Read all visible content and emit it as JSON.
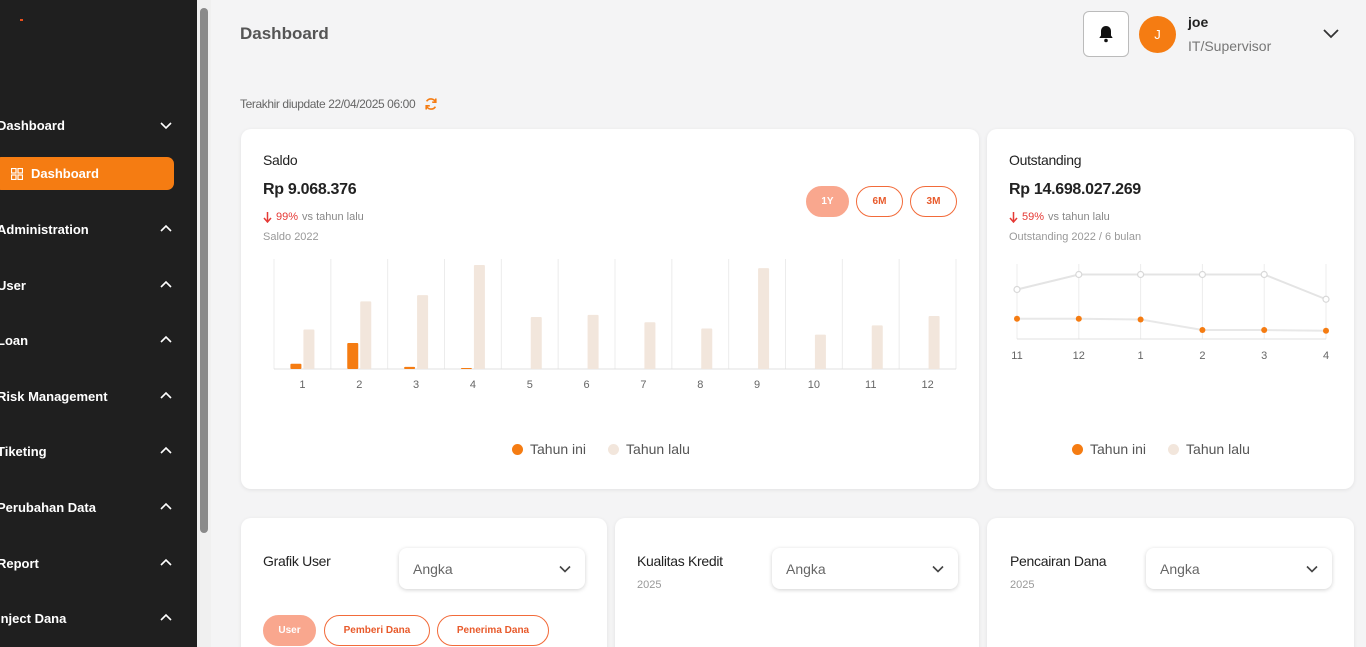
{
  "sidebar": {
    "groups": [
      {
        "label": "Dashboard",
        "expanded": true
      },
      {
        "label": "Administration",
        "expanded": false
      },
      {
        "label": "User",
        "expanded": false
      },
      {
        "label": "Loan",
        "expanded": false
      },
      {
        "label": "Risk Management",
        "expanded": false
      },
      {
        "label": "Tiketing",
        "expanded": false
      },
      {
        "label": "Perubahan Data",
        "expanded": false
      },
      {
        "label": "Report",
        "expanded": false
      },
      {
        "label": "Inject Dana",
        "expanded": false
      }
    ],
    "active_item": "Dashboard"
  },
  "header": {
    "title": "Dashboard",
    "user": {
      "initial": "J",
      "name": "joe",
      "role": "IT/Supervisor"
    },
    "last_updated": "Terakhir diupdate 22/04/2025 06:00"
  },
  "saldo": {
    "title": "Saldo",
    "amount": "Rp 9.068.376",
    "delta_pct": "99%",
    "delta_text": "vs tahun lalu",
    "subtitle": "Saldo 2022",
    "ranges": [
      "1Y",
      "6M",
      "3M"
    ],
    "active_range": "1Y",
    "legend": [
      "Tahun ini",
      "Tahun lalu"
    ]
  },
  "outstanding": {
    "title": "Outstanding",
    "amount": "Rp 14.698.027.269",
    "delta_pct": "59%",
    "delta_text": "vs tahun lalu",
    "subtitle": "Outstanding 2022 / 6 bulan",
    "legend": [
      "Tahun ini",
      "Tahun lalu"
    ]
  },
  "grafik_user": {
    "title": "Grafik User",
    "select_value": "Angka",
    "tabs": [
      "User",
      "Pemberi Dana",
      "Penerima Dana"
    ],
    "active_tab": "User"
  },
  "kualitas_kredit": {
    "title": "Kualitas Kredit",
    "year": "2025",
    "select_value": "Angka"
  },
  "pencairan_dana": {
    "title": "Pencairan Dana",
    "year": "2025",
    "select_value": "Angka"
  },
  "colors": {
    "accent": "#f57c12",
    "this_year": "#f57c12",
    "last_year": "#f2e6dc",
    "sidebar_bg": "#1f1f1f",
    "line_last_year": "#e4e4e4"
  },
  "chart_data": [
    {
      "type": "bar",
      "categories": [
        "1",
        "2",
        "3",
        "4",
        "5",
        "6",
        "7",
        "8",
        "9",
        "10",
        "11",
        "12"
      ],
      "series": [
        {
          "name": "Tahun ini",
          "values": [
            5,
            25,
            2,
            1,
            0,
            0,
            0,
            0,
            0,
            0,
            0,
            0
          ]
        },
        {
          "name": "Tahun lalu",
          "values": [
            38,
            65,
            71,
            100,
            50,
            52,
            45,
            39,
            97,
            33,
            42,
            51
          ]
        }
      ],
      "title": "Saldo",
      "ylim": [
        0,
        100
      ],
      "grid": true,
      "legend": "bottom"
    },
    {
      "type": "line",
      "categories": [
        "11",
        "12",
        "1",
        "2",
        "3",
        "4"
      ],
      "series": [
        {
          "name": "Tahun ini",
          "values": [
            27,
            27,
            26,
            12,
            12,
            11
          ]
        },
        {
          "name": "Tahun lalu",
          "values": [
            66,
            86,
            86,
            86,
            86,
            53
          ]
        }
      ],
      "title": "Outstanding",
      "ylim": [
        0,
        100
      ],
      "grid": true,
      "legend": "bottom"
    }
  ]
}
